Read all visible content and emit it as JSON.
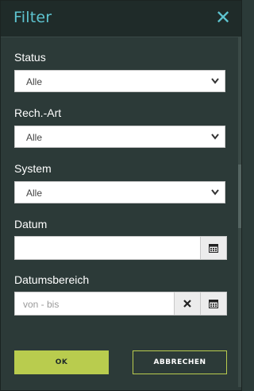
{
  "dialog": {
    "title": "Filter",
    "close_icon": "close-icon"
  },
  "fields": {
    "status": {
      "label": "Status",
      "value": "Alle"
    },
    "rech_art": {
      "label": "Rech.-Art",
      "value": "Alle"
    },
    "system": {
      "label": "System",
      "value": "Alle"
    },
    "datum": {
      "label": "Datum",
      "value": "",
      "icon": "calendar-icon"
    },
    "datumsbereich": {
      "label": "Datumsbereich",
      "placeholder": "von - bis",
      "clear_icon": "clear-icon",
      "icon": "calendar-icon"
    }
  },
  "buttons": {
    "ok": "OK",
    "cancel": "ABBRECHEN"
  },
  "colors": {
    "header_bg": "#1f2b29",
    "body_bg": "#2c3a38",
    "title_color": "#5ec4d0",
    "accent": "#b9cc4e"
  }
}
